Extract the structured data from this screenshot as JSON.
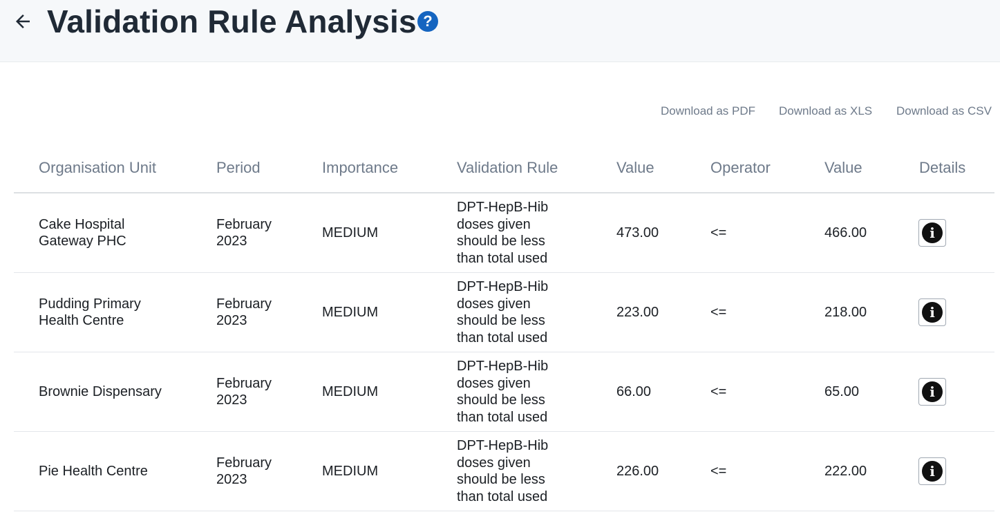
{
  "header": {
    "back_icon": "arrow-left-icon",
    "title": "Validation Rule Analysis",
    "help_icon": "question-circle-icon",
    "help_glyph": "?"
  },
  "downloads": {
    "pdf": "Download as PDF",
    "xls": "Download as XLS",
    "csv": "Download as CSV"
  },
  "table": {
    "columns": [
      "Organisation Unit",
      "Period",
      "Importance",
      "Validation Rule",
      "Value",
      "Operator",
      "Value",
      "Details"
    ],
    "rows": [
      {
        "org_unit": [
          "Cake Hospital",
          "Gateway PHC"
        ],
        "period": [
          "February",
          "2023"
        ],
        "importance": "MEDIUM",
        "rule": [
          "DPT-HepB-Hib",
          "doses given",
          "should be less",
          "than total used"
        ],
        "left_value": "473.00",
        "operator": "<=",
        "right_value": "466.00",
        "details_icon": "info-icon",
        "details_glyph": "i"
      },
      {
        "org_unit": [
          "Pudding Primary",
          "Health Centre"
        ],
        "period": [
          "February",
          "2023"
        ],
        "importance": "MEDIUM",
        "rule": [
          "DPT-HepB-Hib",
          "doses given",
          "should be less",
          "than total used"
        ],
        "left_value": "223.00",
        "operator": "<=",
        "right_value": "218.00",
        "details_icon": "info-icon",
        "details_glyph": "i"
      },
      {
        "org_unit": [
          "Brownie Dispensary"
        ],
        "period": [
          "February",
          "2023"
        ],
        "importance": "MEDIUM",
        "rule": [
          "DPT-HepB-Hib",
          "doses given",
          "should be less",
          "than total used"
        ],
        "left_value": "66.00",
        "operator": "<=",
        "right_value": "65.00",
        "details_icon": "info-icon",
        "details_glyph": "i"
      },
      {
        "org_unit": [
          "Pie Health Centre"
        ],
        "period": [
          "February",
          "2023"
        ],
        "importance": "MEDIUM",
        "rule": [
          "DPT-HepB-Hib",
          "doses given",
          "should be less",
          "than total used"
        ],
        "left_value": "226.00",
        "operator": "<=",
        "right_value": "222.00",
        "details_icon": "info-icon",
        "details_glyph": "i"
      }
    ]
  }
}
